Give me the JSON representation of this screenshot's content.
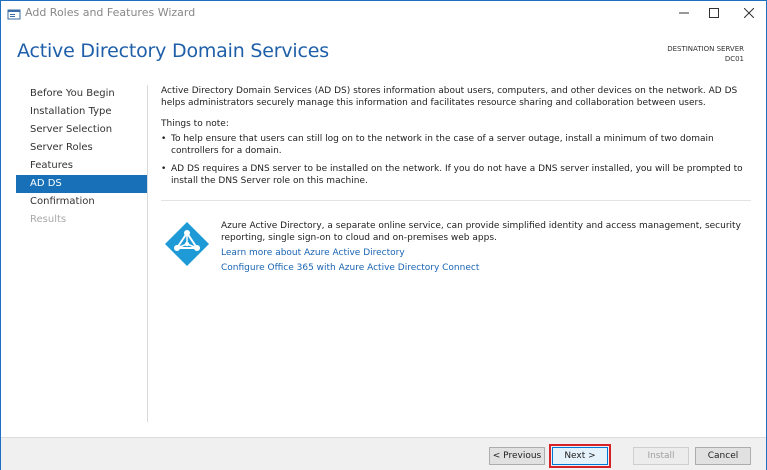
{
  "window": {
    "title": "Add Roles and Features Wizard",
    "accent_color": "#1871b8",
    "title_color": "#1f5fa9"
  },
  "header": {
    "page_title": "Active Directory Domain Services",
    "destination_label": "DESTINATION SERVER",
    "destination_value": "DC01"
  },
  "nav": {
    "items": [
      {
        "label": "Before You Begin",
        "state": "normal"
      },
      {
        "label": "Installation Type",
        "state": "normal"
      },
      {
        "label": "Server Selection",
        "state": "normal"
      },
      {
        "label": "Server Roles",
        "state": "normal"
      },
      {
        "label": "Features",
        "state": "normal"
      },
      {
        "label": "AD DS",
        "state": "active"
      },
      {
        "label": "Confirmation",
        "state": "normal"
      },
      {
        "label": "Results",
        "state": "disabled"
      }
    ]
  },
  "content": {
    "intro": "Active Directory Domain Services (AD DS) stores information about users, computers, and other devices on the network.  AD DS helps administrators securely manage this information and facilitates resource sharing and collaboration between users.",
    "things_to_note": "Things to note:",
    "bullets": [
      "To help ensure that users can still log on to the network in the case of a server outage, install a minimum of two domain controllers for a domain.",
      "AD DS requires a DNS server to be installed on the network.  If you do not have a DNS server installed, you will be prompted to install the DNS Server role on this machine."
    ],
    "azure_text": "Azure Active Directory, a separate online service, can provide simplified identity and access management, security reporting, single sign-on to cloud and on-premises web apps.",
    "azure_icon": "azure-ad-icon",
    "link_learn": "Learn more about Azure Active Directory",
    "link_configure": "Configure Office 365 with Azure Active Directory Connect"
  },
  "footer": {
    "previous": "< Previous",
    "next": "Next >",
    "install": "Install",
    "cancel": "Cancel",
    "highlight_color": "#d8202a"
  }
}
